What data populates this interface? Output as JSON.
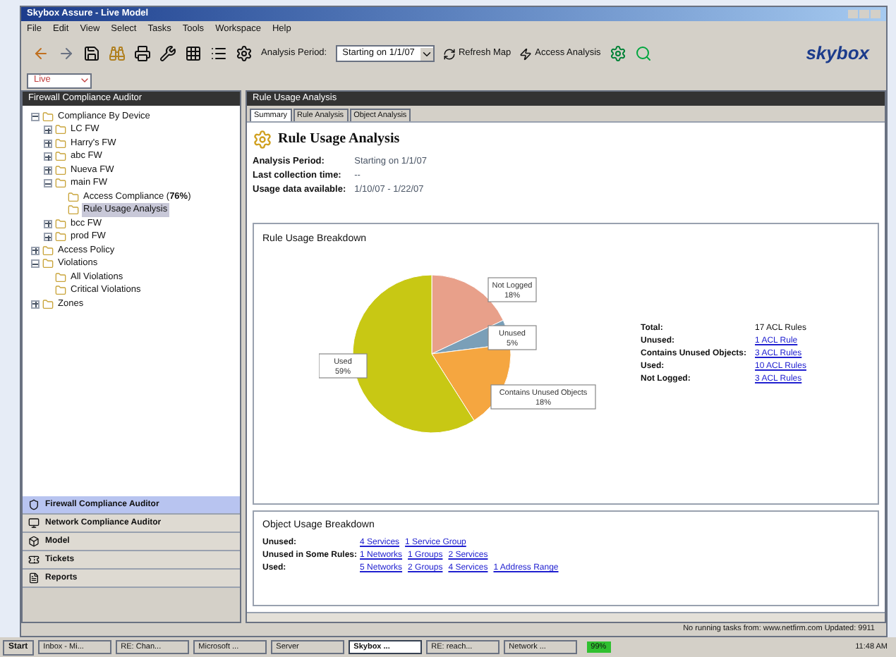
{
  "window": {
    "title": "Skybox Assure - Live Model"
  },
  "menu": [
    "File",
    "Edit",
    "View",
    "Select",
    "Tasks",
    "Tools",
    "Workspace",
    "Help"
  ],
  "toolbar": {
    "period_label": "Analysis Period:",
    "period_value": "Starting on 1/1/07",
    "refresh": "Refresh Map",
    "access": "Access Analysis",
    "logo": "skybox",
    "model": "Live"
  },
  "left_panel": {
    "title": "Firewall Compliance Auditor",
    "tree": [
      {
        "label": "Compliance By Device",
        "expanded": true,
        "children": [
          {
            "label": "LC FW",
            "expanded": false
          },
          {
            "label": "Harry's FW",
            "expanded": false
          },
          {
            "label": "abc FW",
            "expanded": false
          },
          {
            "label": "Nueva FW",
            "expanded": false
          },
          {
            "label": "main FW",
            "expanded": true,
            "children": [
              {
                "label": "Access Compliance (**76%**)",
                "selected": false
              },
              {
                "label": "Rule Usage Analysis",
                "selected": true
              }
            ]
          },
          {
            "label": "bcc FW",
            "expanded": false
          },
          {
            "label": "prod FW",
            "expanded": false
          }
        ]
      },
      {
        "label": "Access Policy",
        "expanded": false
      },
      {
        "label": "Violations",
        "expanded": true,
        "children": [
          {
            "label": "All Violations",
            "selected": false
          },
          {
            "label": "Critical Violations",
            "selected": false
          }
        ]
      },
      {
        "label": "Zones",
        "expanded": false
      }
    ],
    "nav": [
      {
        "label": "Firewall Compliance Auditor",
        "selected": true
      },
      {
        "label": "Network Compliance Auditor",
        "selected": false
      },
      {
        "label": "Model",
        "selected": false
      },
      {
        "label": "Tickets",
        "selected": false
      },
      {
        "label": "Reports",
        "selected": false
      }
    ]
  },
  "main": {
    "title": "Rule Usage Analysis",
    "tabs": [
      {
        "label": "Summary",
        "selected": true
      },
      {
        "label": "Rule Analysis",
        "selected": false
      },
      {
        "label": "Object Analysis",
        "selected": false
      }
    ],
    "heading": "Rule Usage Analysis",
    "info": [
      {
        "label": "Analysis Period:",
        "value": "Starting on 1/1/07"
      },
      {
        "label": "Last collection time:",
        "value": "--"
      },
      {
        "label": "Usage data available:",
        "value": "1/10/07 - 1/22/07"
      }
    ],
    "rule_breakdown": {
      "title": "Rule Usage Breakdown",
      "chart_data": {
        "type": "pie",
        "categories": [
          "Not Logged",
          "Unused",
          "Contains Unused Objects",
          "Used"
        ],
        "values": [
          18,
          5,
          18,
          59
        ],
        "colors": [
          "#e8a08a",
          "#7a9fb8",
          "#f5a640",
          "#c8c814"
        ],
        "value_labels": [
          "18%",
          "5%",
          "18%",
          "59%"
        ]
      },
      "totals": [
        {
          "label": "Total:",
          "value": "17 ACL Rules",
          "link": false
        },
        {
          "label": "Unused:",
          "value": "1 ACL Rule",
          "link": true
        },
        {
          "label": "Contains Unused Objects:",
          "value": "3 ACL Rules",
          "link": true
        },
        {
          "label": "Used:",
          "value": "10 ACL Rules",
          "link": true
        },
        {
          "label": "Not Logged:",
          "value": "3 ACL Rules",
          "link": true
        }
      ]
    },
    "object_breakdown": {
      "title": "Object Usage Breakdown",
      "rows": [
        {
          "label": "Unused:",
          "links": [
            "4 Services",
            "1 Service Group"
          ]
        },
        {
          "label": "Unused in Some Rules:",
          "links": [
            "1 Networks",
            "1 Groups",
            "2 Services"
          ]
        },
        {
          "label": "Used:",
          "links": [
            "5 Networks",
            "2 Groups",
            "4 Services",
            "1 Address Range"
          ]
        }
      ]
    }
  },
  "status_bar": "No running tasks from: www.netfirm.com  Updated: 9911",
  "taskbar": {
    "start": "Start",
    "tasks": [
      {
        "label": "Inbox - Mi...",
        "selected": false
      },
      {
        "label": "RE: Chan...",
        "selected": false
      },
      {
        "label": "Microsoft ...",
        "selected": false
      },
      {
        "label": "Server",
        "selected": false
      },
      {
        "label": "Skybox ...",
        "selected": true
      },
      {
        "label": "RE: reach...",
        "selected": false
      },
      {
        "label": "Network ...",
        "selected": false
      }
    ],
    "battery": "99%",
    "clock": "11:48 AM"
  }
}
